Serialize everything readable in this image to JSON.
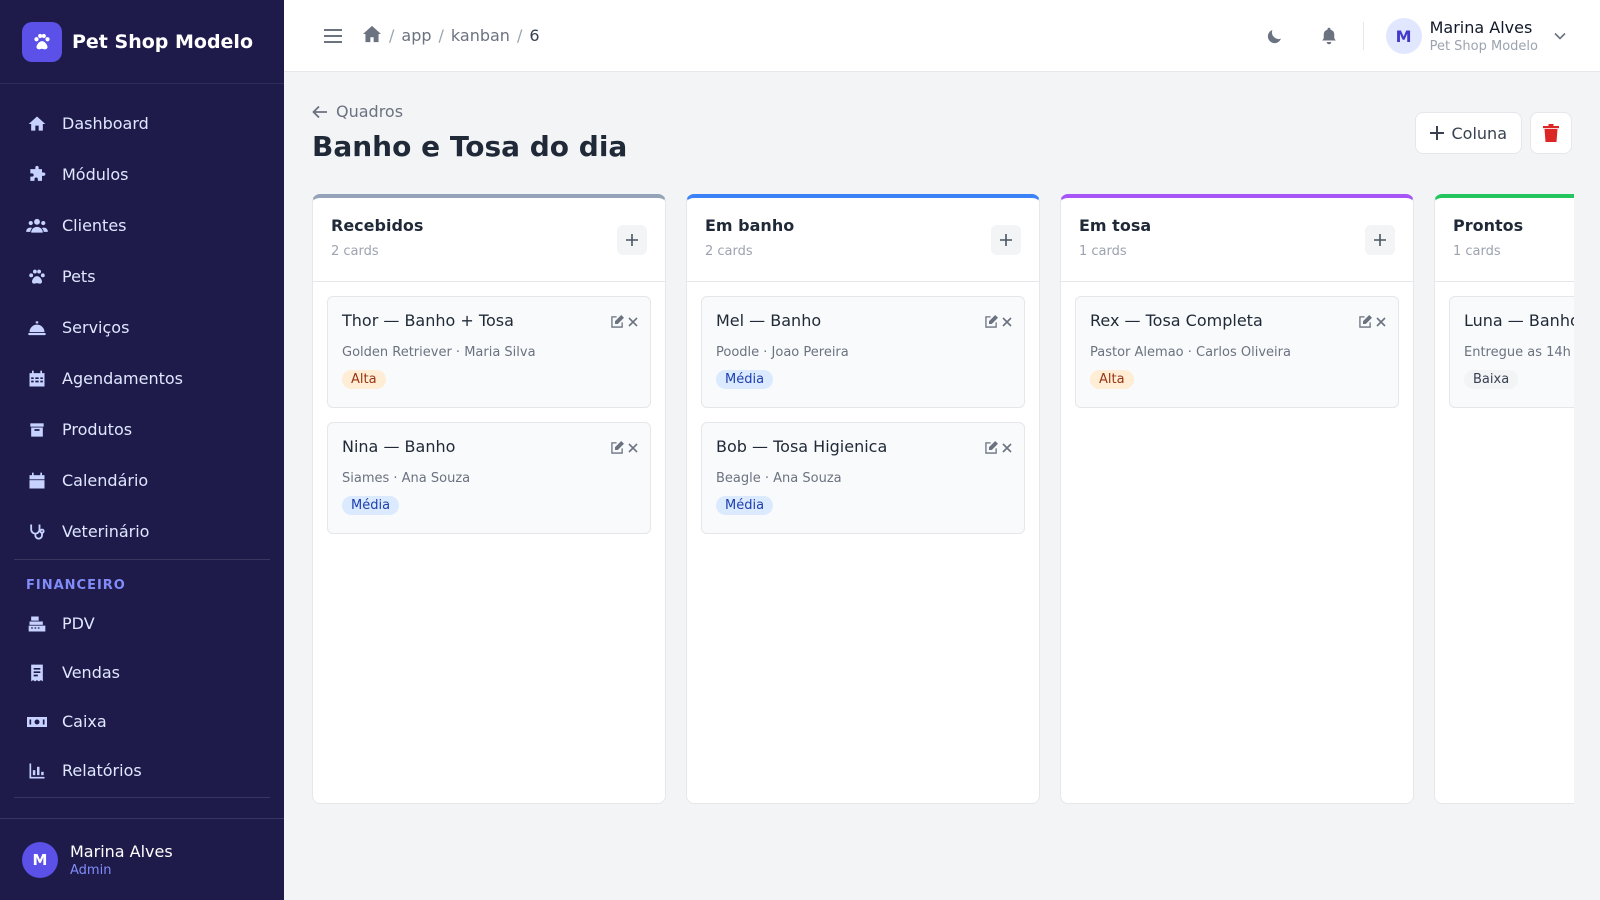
{
  "app": {
    "name": "Pet Shop Modelo"
  },
  "sidebar": {
    "items": [
      {
        "label": "Dashboard",
        "icon": "home-icon"
      },
      {
        "label": "Módulos",
        "icon": "puzzle-icon"
      },
      {
        "label": "Clientes",
        "icon": "users-icon"
      },
      {
        "label": "Pets",
        "icon": "paw-icon"
      },
      {
        "label": "Serviços",
        "icon": "bell-service-icon"
      },
      {
        "label": "Agendamentos",
        "icon": "calendar-grid-icon"
      },
      {
        "label": "Produtos",
        "icon": "box-icon"
      },
      {
        "label": "Calendário",
        "icon": "calendar-icon"
      },
      {
        "label": "Veterinário",
        "icon": "stethoscope-icon"
      }
    ],
    "section_financeiro": "FINANCEIRO",
    "finance_items": [
      {
        "label": "PDV",
        "icon": "cash-register-icon"
      },
      {
        "label": "Vendas",
        "icon": "receipt-icon"
      },
      {
        "label": "Caixa",
        "icon": "money-icon"
      },
      {
        "label": "Relatórios",
        "icon": "chart-icon"
      }
    ],
    "user": {
      "initial": "M",
      "name": "Marina Alves",
      "role": "Admin"
    }
  },
  "topbar": {
    "breadcrumb": [
      "app",
      "kanban",
      "6"
    ],
    "user": {
      "initial": "M",
      "name": "Marina Alves",
      "org": "Pet Shop Modelo"
    }
  },
  "page": {
    "back_label": "Quadros",
    "title": "Banho e Tosa do dia",
    "add_column_label": "Coluna"
  },
  "columns": [
    {
      "name": "Recebidos",
      "count": "2 cards",
      "color": "#94a3b8",
      "cards": [
        {
          "title": "Thor — Banho + Tosa",
          "sub": "Golden Retriever · Maria Silva",
          "tag": "Alta",
          "tag_type": "alta"
        },
        {
          "title": "Nina — Banho",
          "sub": "Siames · Ana Souza",
          "tag": "Média",
          "tag_type": "media"
        }
      ]
    },
    {
      "name": "Em banho",
      "count": "2 cards",
      "color": "#3b82f6",
      "cards": [
        {
          "title": "Mel — Banho",
          "sub": "Poodle · Joao Pereira",
          "tag": "Média",
          "tag_type": "media"
        },
        {
          "title": "Bob — Tosa Higienica",
          "sub": "Beagle · Ana Souza",
          "tag": "Média",
          "tag_type": "media"
        }
      ]
    },
    {
      "name": "Em tosa",
      "count": "1 cards",
      "color": "#a855f7",
      "cards": [
        {
          "title": "Rex — Tosa Completa",
          "sub": "Pastor Alemao · Carlos Oliveira",
          "tag": "Alta",
          "tag_type": "alta"
        }
      ]
    },
    {
      "name": "Prontos",
      "count": "1 cards",
      "color": "#22c55e",
      "cards": [
        {
          "title": "Luna — Banho",
          "sub": "Entregue as 14h",
          "tag": "Baixa",
          "tag_type": "baixa"
        }
      ]
    }
  ]
}
